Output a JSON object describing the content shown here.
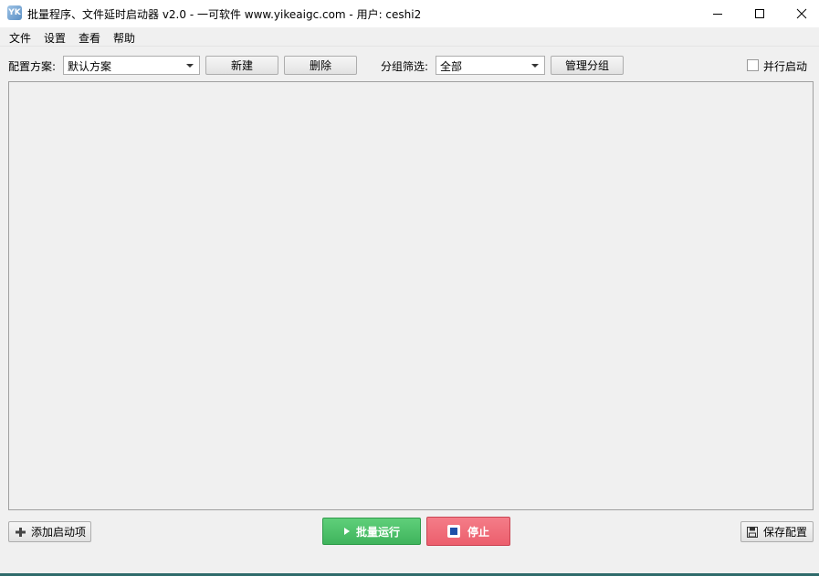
{
  "window": {
    "title": "批量程序、文件延时启动器 v2.0 - 一可软件 www.yikeaigc.com - 用户: ceshi2",
    "icon_text": "YK"
  },
  "menu": {
    "items": [
      "文件",
      "设置",
      "查看",
      "帮助"
    ]
  },
  "toolbar": {
    "profile_label": "配置方案:",
    "profile_value": "默认方案",
    "new_label": "新建",
    "delete_label": "删除",
    "group_filter_label": "分组筛选:",
    "group_filter_value": "全部",
    "manage_group_label": "管理分组",
    "parallel_label": "并行启动",
    "parallel_checked": false
  },
  "bottom": {
    "add_item_label": "添加启动项",
    "run_label": "批量运行",
    "stop_label": "停止",
    "save_label": "保存配置"
  },
  "colors": {
    "run": "#3fb45c",
    "stop": "#ec5f6d"
  }
}
